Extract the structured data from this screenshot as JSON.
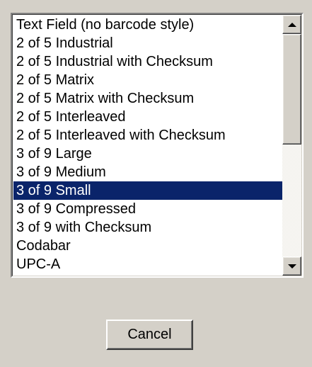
{
  "listbox": {
    "items": [
      "Text Field (no barcode style)",
      "2 of 5 Industrial",
      "2 of 5 Industrial with Checksum",
      "2 of 5 Matrix",
      "2 of 5 Matrix with Checksum",
      "2 of 5 Interleaved",
      "2 of 5 Interleaved with Checksum",
      "3 of 9 Large",
      "3 of 9 Medium",
      "3 of 9 Small",
      "3 of 9 Compressed",
      "3 of 9 with Checksum",
      "Codabar",
      "UPC-A"
    ],
    "selected_item": "3 of 9 Small",
    "scrollbar": {
      "up_icon": "triangle-up-icon",
      "down_icon": "triangle-down-icon"
    }
  },
  "buttons": {
    "cancel_label": "Cancel"
  },
  "colors": {
    "background": "#d4d0c8",
    "selection": "#0a246a",
    "selection_text": "#ffffff"
  }
}
